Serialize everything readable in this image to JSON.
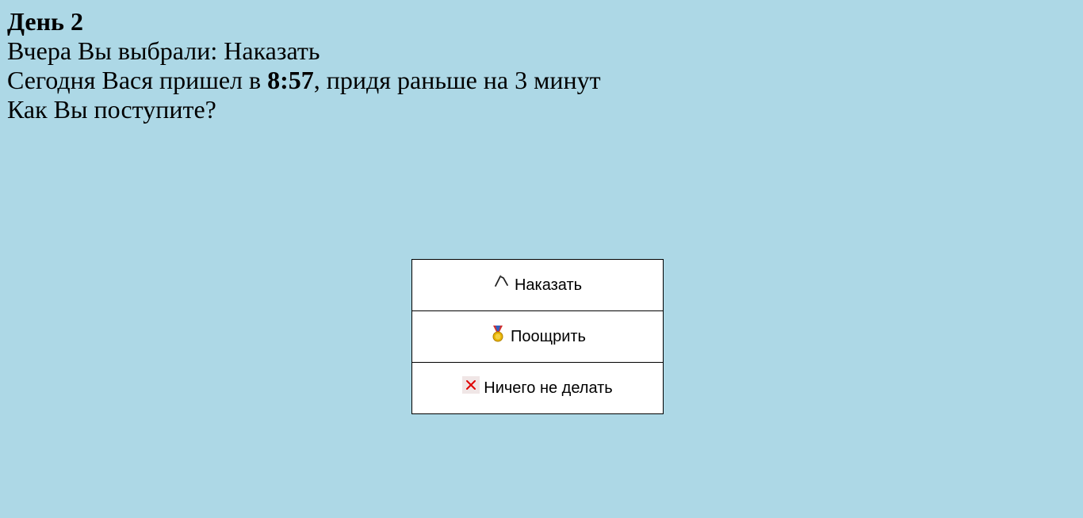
{
  "header": {
    "day_title": "День 2",
    "yesterday_line": "Вчера Вы выбрали: Наказать",
    "today_prefix": "Сегодня Вася пришел в ",
    "today_time": "8:57",
    "today_suffix": ", придя раньше на 3 минут",
    "question": "Как Вы поступите?"
  },
  "actions": [
    {
      "label": "Наказать",
      "icon": "whip-icon"
    },
    {
      "label": "Поощрить",
      "icon": "medal-icon"
    },
    {
      "label": "Ничего не делать",
      "icon": "cross-icon"
    }
  ],
  "colors": {
    "background": "#add8e6",
    "button_background": "#ffffff",
    "button_border": "#000000",
    "cross": "#e00000",
    "medal_gold": "#e8b400",
    "medal_ribbon": "#d03030"
  }
}
